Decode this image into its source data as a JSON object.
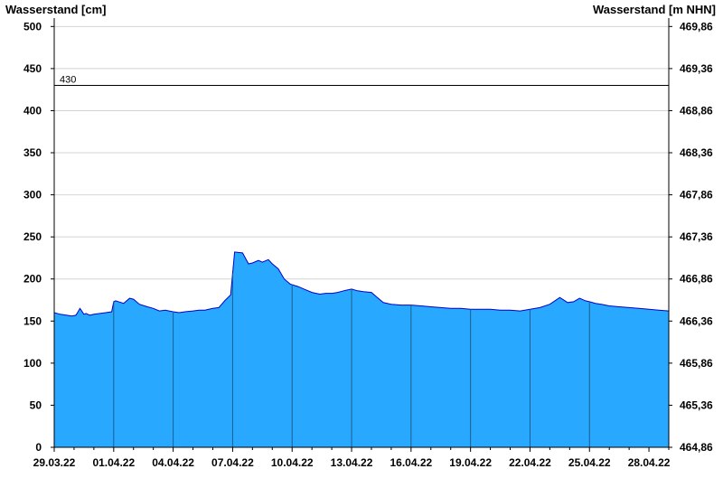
{
  "chart_data": {
    "type": "area",
    "ylabel_left": "Wasserstand [cm]",
    "ylabel_right": "Wasserstand [m NHN]",
    "ylim": [
      0,
      510
    ],
    "left_ticks": [
      0,
      50,
      100,
      150,
      200,
      250,
      300,
      350,
      400,
      450,
      500
    ],
    "right_ticks": [
      "464,86",
      "465,36",
      "465,86",
      "466,36",
      "466,86",
      "467,36",
      "467,86",
      "468,36",
      "468,86",
      "469,36",
      "469,86"
    ],
    "x_ticks": [
      "29.03.22",
      "01.04.22",
      "04.04.22",
      "07.04.22",
      "10.04.22",
      "13.04.22",
      "16.04.22",
      "19.04.22",
      "22.04.22",
      "25.04.22",
      "28.04.22"
    ],
    "x_range_days": [
      0,
      31
    ],
    "reference_line": {
      "value": 430,
      "label": "430"
    },
    "grid": true,
    "colors": {
      "fill": "#29a8ff",
      "line": "#0000cc",
      "grid": "#d4d4d4",
      "ref": "#000000"
    },
    "series": [
      {
        "x": [
          0,
          0.3,
          0.6,
          0.9,
          1.1,
          1.3,
          1.5,
          1.6,
          1.8,
          2.0,
          2.3,
          2.6,
          2.9,
          3.0,
          3.1,
          3.5,
          3.8,
          4.0,
          4.3,
          4.7,
          5.0,
          5.3,
          5.6,
          6.0,
          6.3,
          6.6,
          7.0,
          7.3,
          7.6,
          8.0,
          8.3,
          8.6,
          8.9,
          9.1,
          9.5,
          9.8,
          10.0,
          10.3,
          10.5,
          10.8,
          11.0,
          11.3,
          11.6,
          11.9,
          12.3,
          12.6,
          13.0,
          13.4,
          13.7,
          14.0,
          14.3,
          14.6,
          15.0,
          15.3,
          15.6,
          16.0,
          16.3,
          16.6,
          17.0,
          17.5,
          18.0,
          18.5,
          19.0,
          19.5,
          20.0,
          20.5,
          21.0,
          21.5,
          22.0,
          22.5,
          23.0,
          23.5,
          24.0,
          24.5,
          25.0,
          25.5,
          25.9,
          26.2,
          26.5,
          26.8,
          27.0,
          27.3,
          27.6,
          28.0,
          28.5,
          29.0,
          29.5,
          30.0,
          30.5,
          31.0
        ],
        "values": [
          160,
          158,
          157,
          156,
          157,
          165,
          158,
          159,
          157,
          158,
          159,
          160,
          161,
          173,
          174,
          171,
          177,
          176,
          170,
          167,
          165,
          162,
          163,
          161,
          160,
          161,
          162,
          163,
          163,
          165,
          166,
          174,
          181,
          232,
          231,
          218,
          219,
          222,
          220,
          223,
          218,
          212,
          200,
          194,
          191,
          188,
          184,
          182,
          183,
          183,
          184,
          186,
          188,
          186,
          185,
          184,
          178,
          172,
          170,
          169,
          169,
          168,
          167,
          166,
          165,
          165,
          164,
          164,
          164,
          163,
          163,
          162,
          164,
          166,
          170,
          178,
          172,
          173,
          177,
          174,
          173,
          171,
          170,
          168,
          167,
          166,
          165,
          164,
          163,
          162
        ]
      }
    ]
  }
}
